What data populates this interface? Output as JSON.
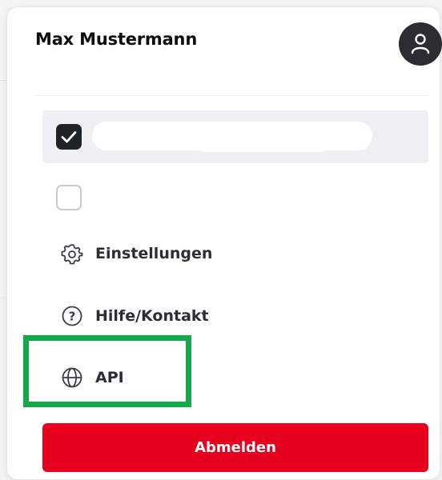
{
  "user": {
    "name": "Max Mustermann",
    "avatar_icon": "user-icon"
  },
  "accounts": [
    {
      "checked": true,
      "label": ""
    },
    {
      "checked": false,
      "label": ""
    }
  ],
  "menu": {
    "items": [
      {
        "label": "Einstellungen",
        "icon": "gear-icon"
      },
      {
        "label": "Hilfe/Kontakt",
        "icon": "help-circle-icon"
      },
      {
        "label": "API",
        "icon": "globe-icon"
      }
    ]
  },
  "logout_label": "Abmelden",
  "colors": {
    "logout": "#e6001e",
    "highlight": "#13a84a",
    "avatar": "#2a2d33",
    "selected_row": "#eef0f3"
  }
}
